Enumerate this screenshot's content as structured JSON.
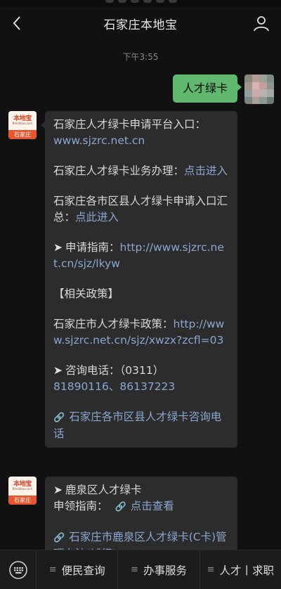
{
  "header": {
    "title": "石家庄本地宝",
    "back_icon": "chevron-left-icon",
    "profile_icon": "person-icon"
  },
  "chat": {
    "timestamp": "下午3:55",
    "outgoing": {
      "text": "人才绿卡"
    },
    "bot_avatar": {
      "brand": "本地宝",
      "brand_sub": "Bendibao.com",
      "city": "石家庄"
    },
    "message1": {
      "p1_label": "石家庄人才绿卡申请平台入口：",
      "p1_link": "www.sjzrc.net.cn",
      "p2_label": "石家庄人才绿卡业务办理：",
      "p2_link": "点击进入",
      "p3_label": "石家庄各市区县人才绿卡申请入口汇总：",
      "p3_link": "点此进入",
      "p4_arrow": "➤",
      "p4_label": "申请指南：",
      "p4_link": "http://www.sjzrc.net.cn/sjz/lkyw",
      "p5_heading": "【相关政策】",
      "p6_label": "石家庄市人才绿卡政策：",
      "p6_link": "http://www.sjzrc.net.cn/sjz/xwzx?zcfl=03",
      "p7_arrow": "➤",
      "p7_label": "咨询电话：（0311）",
      "p7_phones": "81890116、86137223",
      "p8_link_icon": "🔗",
      "p8_link": "石家庄各市区县人才绿卡咨询电话"
    },
    "message2": {
      "l1_arrow": "➤",
      "l1_text": "鹿泉区人才绿卡",
      "l2_label": "申领指南：",
      "l2_link_icon": "🔗",
      "l2_link": "点击查看",
      "l3_link_icon": "🔗",
      "l3_link": "石家庄市鹿泉区人才绿卡(C卡)管理办法(试行)"
    }
  },
  "bottom_menu": {
    "keyboard_icon": "keyboard-icon",
    "items": [
      {
        "label": "便民查询"
      },
      {
        "label": "办事服务"
      },
      {
        "label": "人才丨求职"
      }
    ]
  }
}
